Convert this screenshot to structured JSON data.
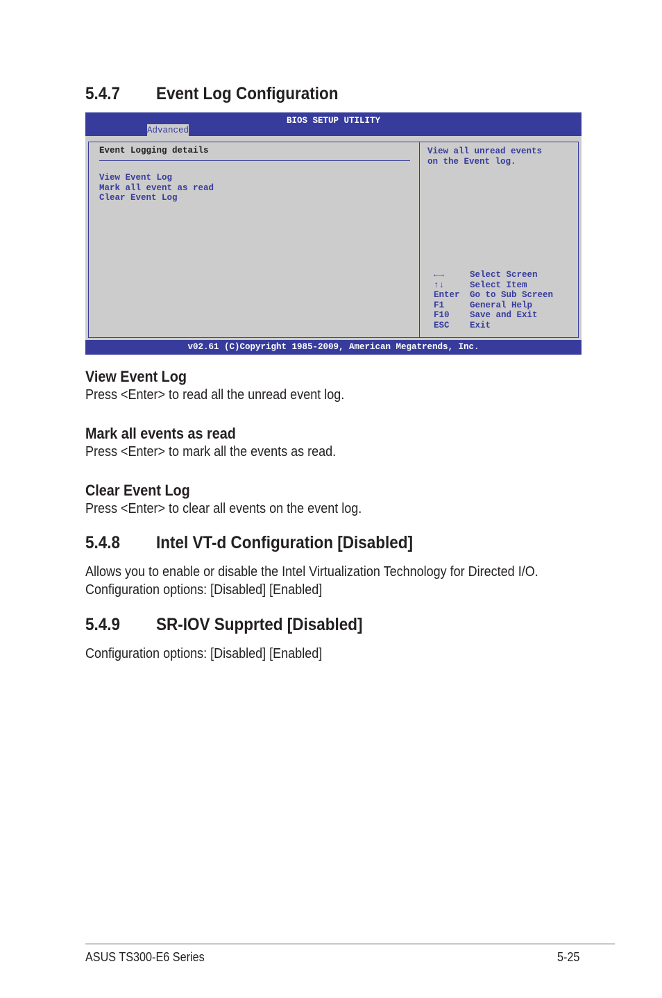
{
  "section_547": {
    "number": "5.4.7",
    "title": "Event Log Configuration"
  },
  "bios": {
    "title": "BIOS SETUP UTILITY",
    "active_tab": "Advanced",
    "panel_heading": "Event Logging details",
    "items": [
      "View Event Log",
      "Mark all event as read",
      "Clear Event Log"
    ],
    "help_text": [
      "View all unread events",
      "on the Event log."
    ],
    "keys": [
      {
        "key": "←→",
        "action": "Select Screen"
      },
      {
        "key": "↑↓",
        "action": "Select Item"
      },
      {
        "key": "Enter",
        "action": "Go to Sub Screen"
      },
      {
        "key": "F1",
        "action": "General Help"
      },
      {
        "key": "F10",
        "action": "Save and Exit"
      },
      {
        "key": "ESC",
        "action": "Exit"
      }
    ],
    "footer": "v02.61 (C)Copyright 1985-2009, American Megatrends, Inc.",
    "colors": {
      "bar": "#373c9c",
      "panel": "#cccccc"
    }
  },
  "items_desc": [
    {
      "title": "View Event Log",
      "text": "Press <Enter> to read all the unread event log."
    },
    {
      "title": "Mark all events as read",
      "text": "Press <Enter> to mark all the events as read."
    },
    {
      "title": "Clear Event Log",
      "text": "Press <Enter> to clear all events on the event log."
    }
  ],
  "section_548": {
    "number": "5.4.8",
    "title": "Intel VT-d Configuration [Disabled]",
    "text1": "Allows you to enable or disable the Intel Virtualization Technology for Directed I/O.",
    "text2": "Configuration options: [Disabled] [Enabled]"
  },
  "section_549": {
    "number": "5.4.9",
    "title": "SR-IOV Supprted [Disabled]",
    "text1": "Configuration options: [Disabled] [Enabled]"
  },
  "footer": {
    "left": "ASUS TS300-E6 Series",
    "right": "5-25"
  }
}
